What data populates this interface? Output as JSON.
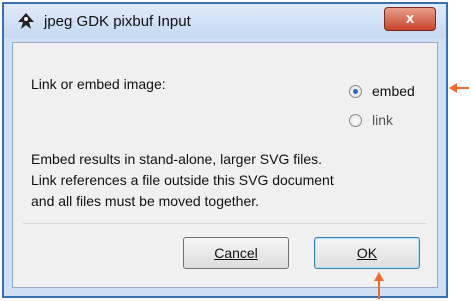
{
  "window": {
    "title": "jpeg GDK pixbuf Input",
    "close_glyph": "x"
  },
  "form": {
    "prompt": "Link or embed image:",
    "options": [
      {
        "label": "embed",
        "selected": true
      },
      {
        "label": "link",
        "selected": false
      }
    ],
    "description_lines": [
      "Embed results in stand-alone, larger SVG files.",
      "Link references a file outside this SVG document",
      "and all files must be moved together."
    ]
  },
  "buttons": {
    "cancel_label": "Cancel",
    "ok_label": "OK"
  },
  "annotations": {
    "arrow_color": "#ee6a2f"
  },
  "icons": {
    "app": "inkscape-icon",
    "close": "close-icon"
  }
}
